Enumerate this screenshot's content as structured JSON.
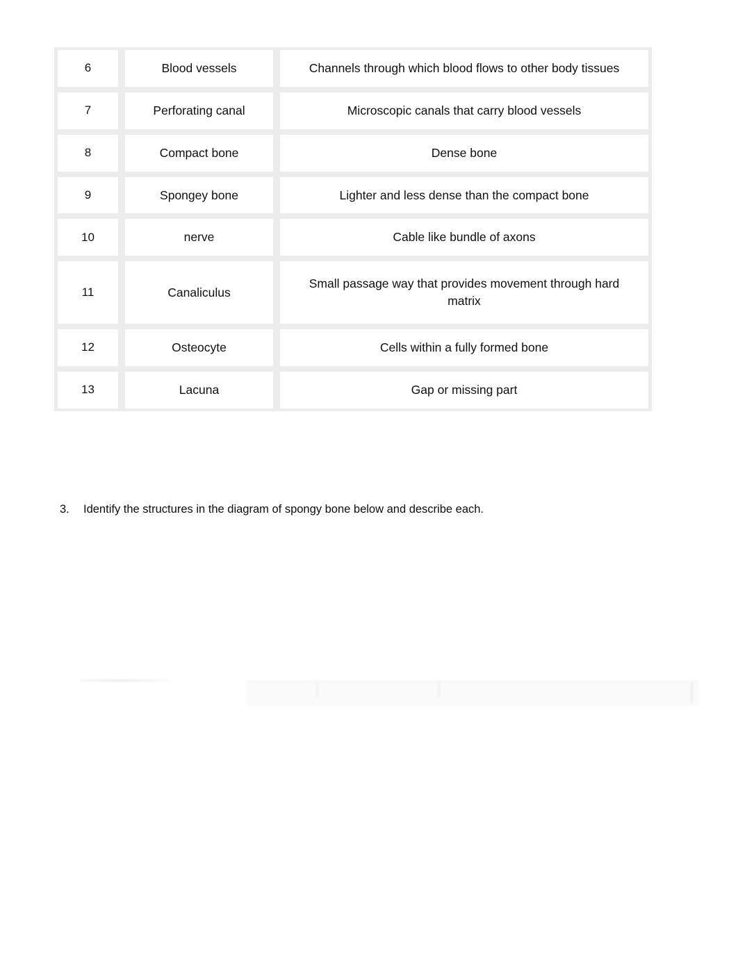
{
  "page": {
    "background_color": "#ffffff",
    "text_color": "#101010"
  },
  "table": {
    "border_color": "#ececec",
    "cell_background": "#ffffff",
    "columns": [
      "number",
      "term",
      "description"
    ],
    "rows": [
      {
        "number": "6",
        "term": "Blood vessels",
        "description": "Channels through which blood flows to other body tissues"
      },
      {
        "number": "7",
        "term": "Perforating canal",
        "description": "Microscopic canals that carry blood vessels"
      },
      {
        "number": "8",
        "term": "Compact bone",
        "description": "Dense bone"
      },
      {
        "number": "9",
        "term": "Spongey bone",
        "description": "Lighter and less dense than the compact bone"
      },
      {
        "number": "10",
        "term": "nerve",
        "description": "Cable like bundle of axons"
      },
      {
        "number": "11",
        "term": "Canaliculus",
        "description": "Small passage way that provides movement through hard matrix"
      },
      {
        "number": "12",
        "term": "Osteocyte",
        "description": "Cells within a fully formed bone"
      },
      {
        "number": "13",
        "term": "Lacuna",
        "description": "Gap or missing part"
      }
    ]
  },
  "instruction": {
    "number": "3.",
    "text": "Identify the structures in the diagram of spongy bone below and describe each."
  }
}
